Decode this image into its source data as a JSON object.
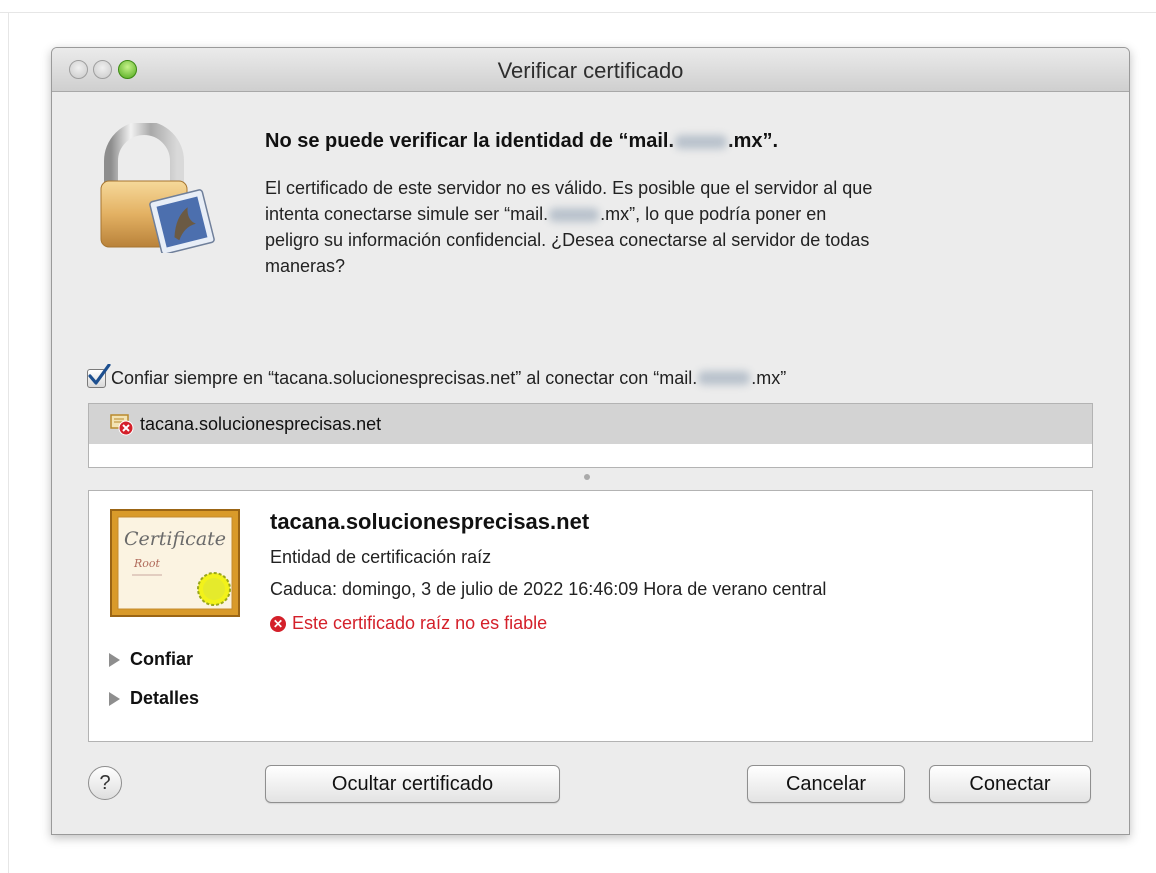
{
  "window": {
    "title": "Verificar certificado"
  },
  "message": {
    "headline_prefix": "No se puede verificar la identidad de “mail.",
    "headline_suffix": ".mx”.",
    "body_line1": "El certificado de este servidor no es válido. Es posible que el servidor al que",
    "body_line2_prefix": "intenta conectarse simule ser “mail.",
    "body_line2_suffix": ".mx”, lo que podría poner en",
    "body_line3": "peligro su información confidencial. ¿Desea conectarse al servidor de todas",
    "body_line4": "maneras?"
  },
  "trust_checkbox": {
    "checked": true,
    "label_prefix": "Confiar siempre en “tacana.solucionesprecisas.net” al conectar con “mail.",
    "label_suffix": ".mx”"
  },
  "certificate_list": {
    "items": [
      "tacana.solucionesprecisas.net"
    ]
  },
  "certificate_detail": {
    "image_text_main": "Certificate",
    "image_text_sub": "Root",
    "common_name": "tacana.solucionesprecisas.net",
    "type": "Entidad de certificación raíz",
    "expires": "Caduca: domingo, 3 de julio de 2022 16:46:09 Hora de verano central",
    "warning": "Este certificado raíz no es fiable",
    "sections": [
      "Confiar",
      "Detalles"
    ]
  },
  "buttons": {
    "help": "?",
    "hide_certificate": "Ocultar certificado",
    "cancel": "Cancelar",
    "connect": "Conectar"
  },
  "colors": {
    "warning": "#d4202a",
    "selection": "#d3d3d3",
    "window_bg": "#ececec"
  }
}
